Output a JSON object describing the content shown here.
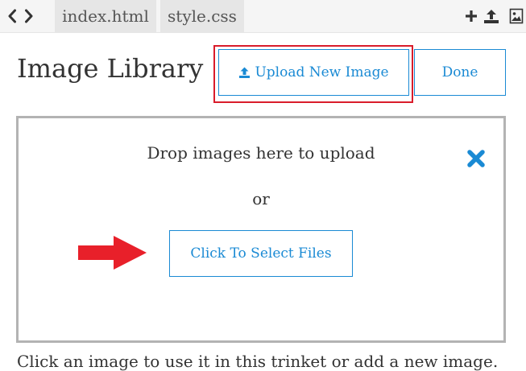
{
  "topbar": {
    "tabs": [
      {
        "label": "index.html"
      },
      {
        "label": "style.css"
      }
    ],
    "icons": [
      "chevron-left-icon",
      "chevron-right-icon",
      "plus-icon",
      "upload-icon",
      "image-icon"
    ]
  },
  "header": {
    "title": "Image Library",
    "upload_label": "Upload New Image",
    "done_label": "Done"
  },
  "dropzone": {
    "drop_text": "Drop images here to upload",
    "or_text": "or",
    "select_label": "Click To Select Files"
  },
  "footer": {
    "text": "Click an image to use it in this trinket or add a new image."
  },
  "colors": {
    "accent": "#1a8ad4",
    "highlight": "#d91c2b",
    "arrow": "#e8202a",
    "dropzone_border": "#b3b3b3"
  }
}
